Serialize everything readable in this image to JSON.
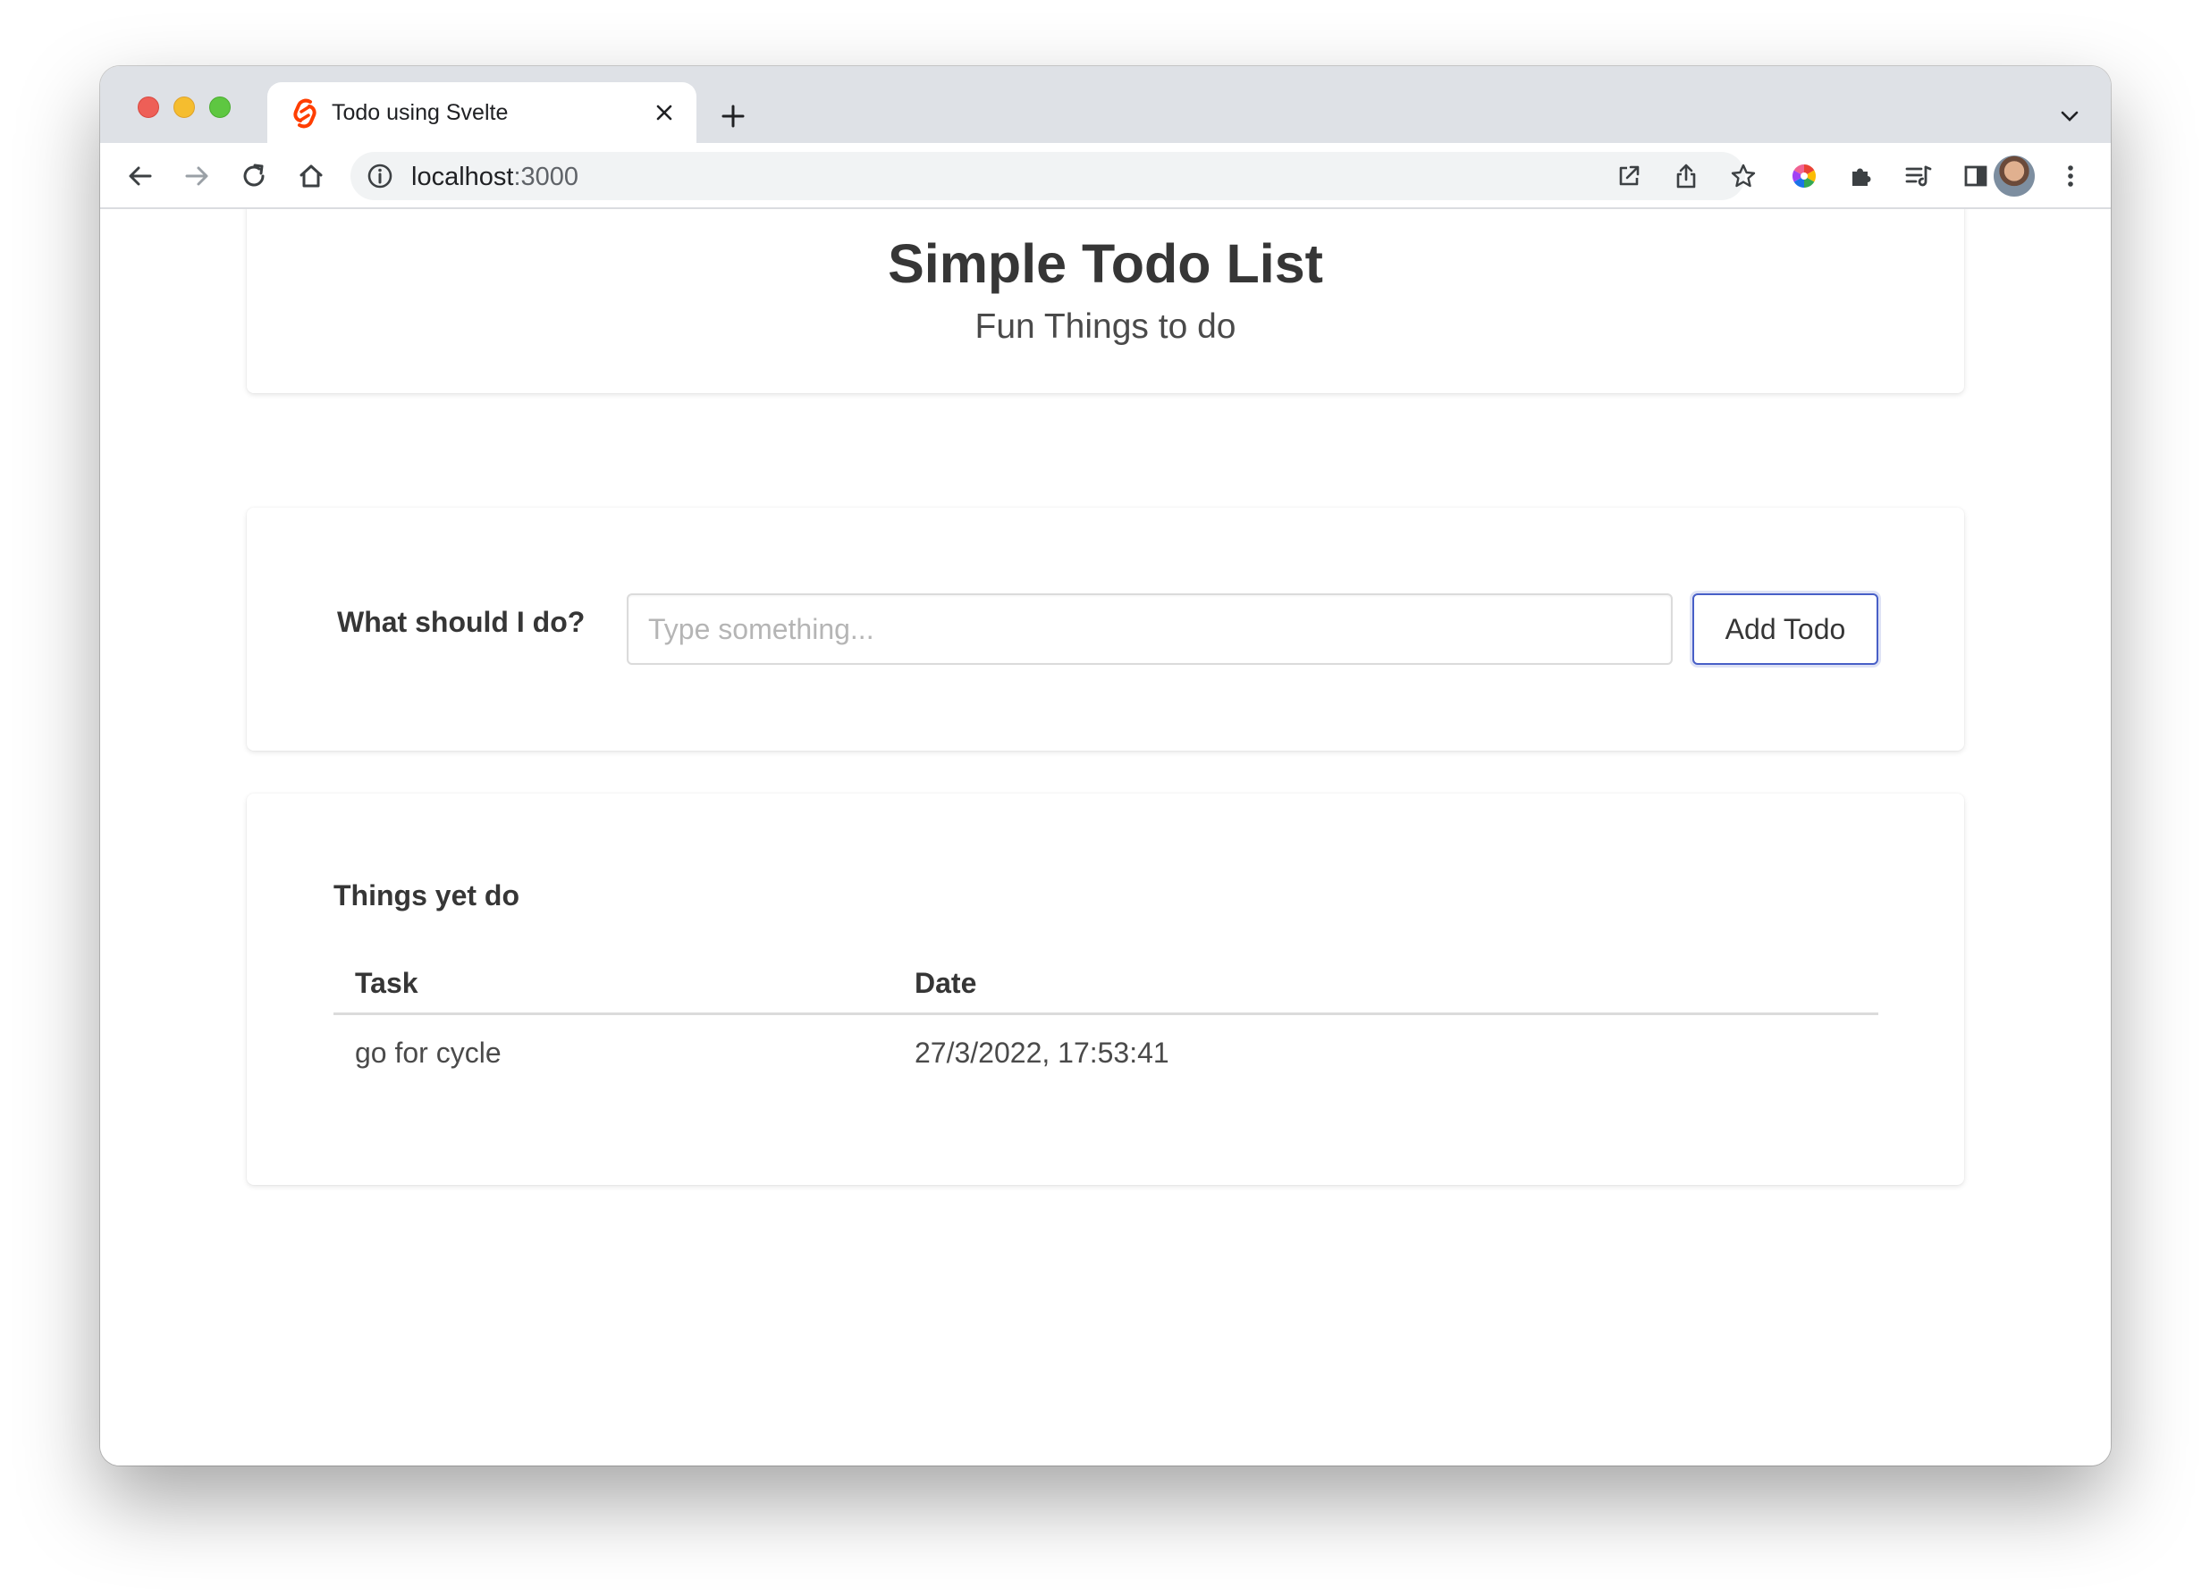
{
  "browser": {
    "tab": {
      "title": "Todo using Svelte",
      "favicon": "svelte-icon"
    },
    "address": {
      "host": "localhost",
      "port": ":3000"
    },
    "toolbar_icons": [
      "back-icon",
      "forward-icon",
      "reload-icon",
      "home-icon",
      "info-icon",
      "open-external-icon",
      "share-icon",
      "bookmark-star-icon",
      "color-wheel-extension-icon",
      "extensions-puzzle-icon",
      "reading-list-icon",
      "side-panel-icon",
      "profile-avatar",
      "menu-kebab-icon"
    ],
    "colors": {
      "tabstrip": "#dee1e6",
      "omnibox": "#f1f3f4",
      "svelte": "#ff3e00"
    }
  },
  "header": {
    "title": "Simple Todo List",
    "subtitle": "Fun Things to do"
  },
  "form": {
    "label": "What should I do?",
    "input_value": "",
    "input_placeholder": "Type something...",
    "button_label": "Add Todo",
    "button_border_color": "#485fc7"
  },
  "list": {
    "title": "Things yet do",
    "columns": [
      "Task",
      "Date"
    ],
    "rows": [
      {
        "task": "go for cycle",
        "date": "27/3/2022, 17:53:41"
      }
    ]
  }
}
